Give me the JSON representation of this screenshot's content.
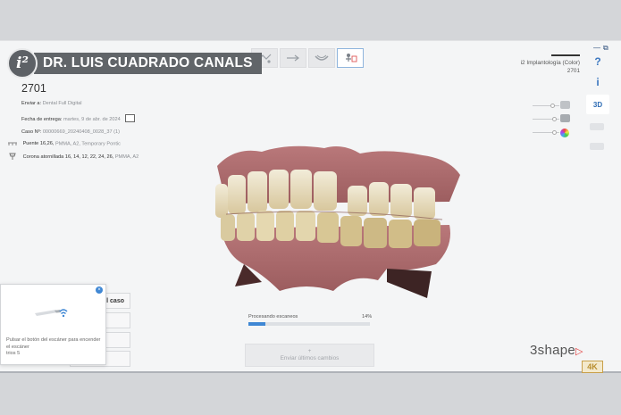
{
  "watermark": {
    "logo_text": "i²",
    "doctor_name": "DR. LUIS CUADRADO CANALS"
  },
  "case": {
    "number": "2701",
    "send_to_label": "Enviar a:",
    "send_to_value": "Dental Full Digital",
    "delivery_label": "Fecha de entrega:",
    "delivery_value": "martes, 9 de abr. de 2024",
    "case_label": "Caso Nº:",
    "case_value": "00000669_20240408_0028_37 (1)",
    "items": [
      {
        "label": "Puente 16,26,",
        "detail": "PMMA, A2, Temporary Pontic"
      },
      {
        "label": "Corona atornillada 16, 14, 12, 22, 24, 26,",
        "detail": "PMMA, A2"
      }
    ]
  },
  "top_right": {
    "line1": "i2 Implantología (Color)",
    "line2": "2701"
  },
  "right_rail": {
    "help": "?",
    "info": "i",
    "view3d": "3D"
  },
  "progress": {
    "label": "Procesando escaneos",
    "percent_text": "14%",
    "percent": 14
  },
  "send_button": {
    "plus": "+",
    "label": "Enviar últimos cambios"
  },
  "left_buttons": {
    "first_label": "l caso"
  },
  "popup": {
    "message": "Pulsar el botón del escáner para encender el escáner",
    "device": "trios 5"
  },
  "brand": {
    "name": "3shape",
    "badge": "4K"
  },
  "colors": {
    "accent": "#3f87d4",
    "banner_bg": "#616569"
  }
}
